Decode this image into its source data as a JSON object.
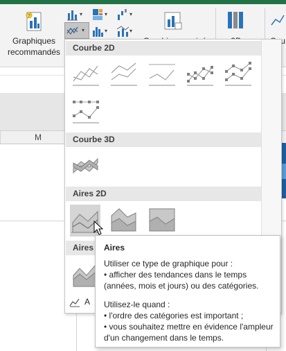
{
  "ribbon": {
    "recommended_line1": "Graphiques",
    "recommended_line2": "recommandés",
    "pivotchart_label": "Graphique croisé",
    "map3d_label": "3D",
    "partial_label": "Cou"
  },
  "sheet": {
    "column_m": "M"
  },
  "gallery": {
    "section_line2d": "Courbe 2D",
    "section_line3d": "Courbe 3D",
    "section_area2d": "Aires 2D",
    "section_area3d_partial": "Aires",
    "footer_partial": "A"
  },
  "tooltip": {
    "title": "Aires",
    "line1": "Utiliser ce type de graphique pour :",
    "line2": "• afficher des tendances dans le temps",
    "line3": "(années, mois et jours) ou des catégories.",
    "line4": "Utilisez-le quand :",
    "line5": "• l'ordre des catégories est important ;",
    "line6": "• vous souhaitez mettre en évidence l'ampleur",
    "line7": "d'un changement dans le temps."
  },
  "colors": {
    "excel_green": "#217346",
    "section_header": "#e7e7e7",
    "hover": "#d5d5d5",
    "chart_gray": "#a0a0a0",
    "chart_blue": "#2b73b8"
  }
}
